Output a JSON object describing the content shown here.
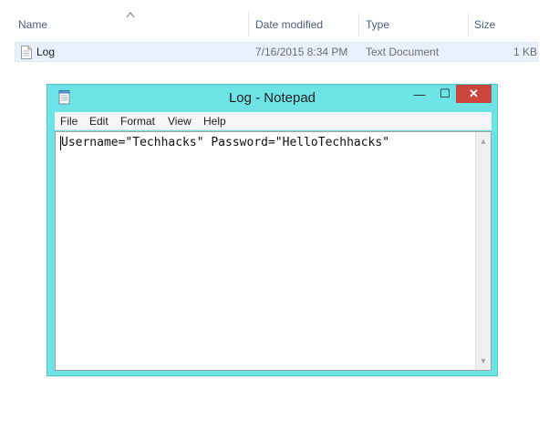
{
  "explorer": {
    "columns": {
      "name": "Name",
      "date_modified": "Date modified",
      "type": "Type",
      "size": "Size"
    },
    "files": [
      {
        "name": "Log",
        "date_modified": "7/16/2015 8:34 PM",
        "type": "Text Document",
        "size": "1 KB",
        "icon": "text-file-icon"
      }
    ]
  },
  "notepad": {
    "title": "Log - Notepad",
    "controls": {
      "minimize": "—",
      "maximize": "☐",
      "close": "✕"
    },
    "menu": [
      "File",
      "Edit",
      "Format",
      "View",
      "Help"
    ],
    "content": "Username=\"Techhacks\" Password=\"HelloTechhacks\"",
    "colors": {
      "frame": "#6ee3e6",
      "close_button": "#c9463d",
      "selection": "#e8f1fb"
    }
  }
}
